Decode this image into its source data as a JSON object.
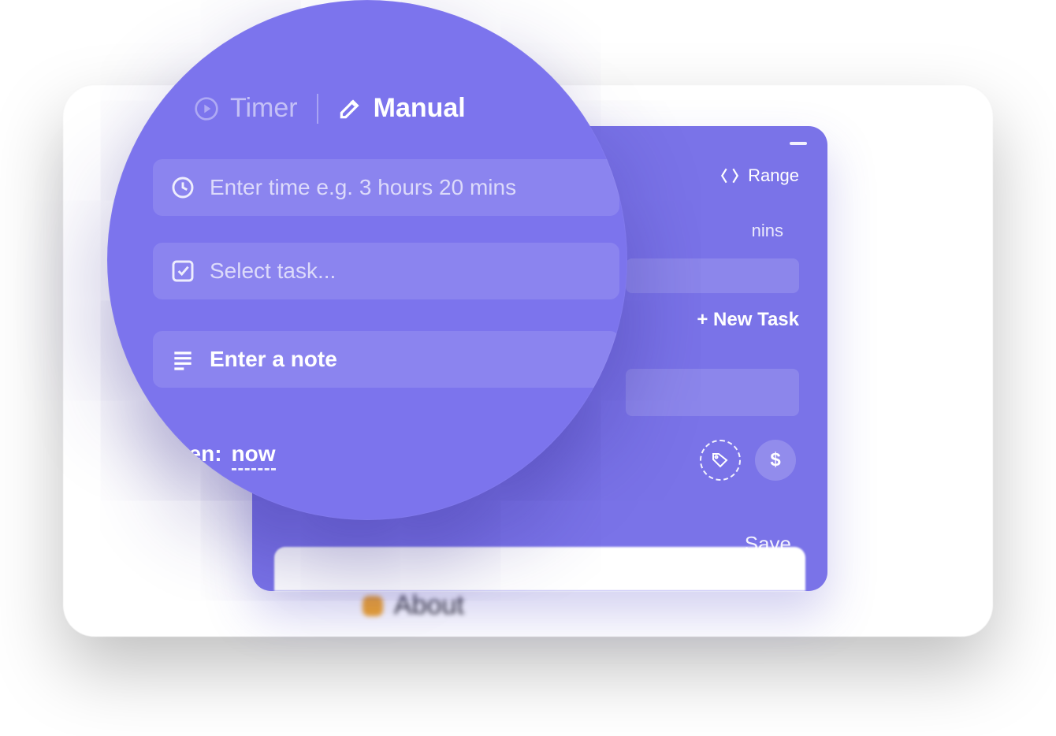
{
  "tabs": {
    "timer": "Timer",
    "manual": "Manual"
  },
  "fields": {
    "time_placeholder": "Enter time e.g. 3 hours 20 mins",
    "task_placeholder": "Select task...",
    "note_placeholder": "Enter a note"
  },
  "when": {
    "label": "When:",
    "value": "now"
  },
  "panel": {
    "range_label": "Range",
    "mins_fragment": "nins",
    "new_task": "+ New Task",
    "save": "Save",
    "dollar": "$"
  },
  "peek": {
    "label": "About"
  }
}
